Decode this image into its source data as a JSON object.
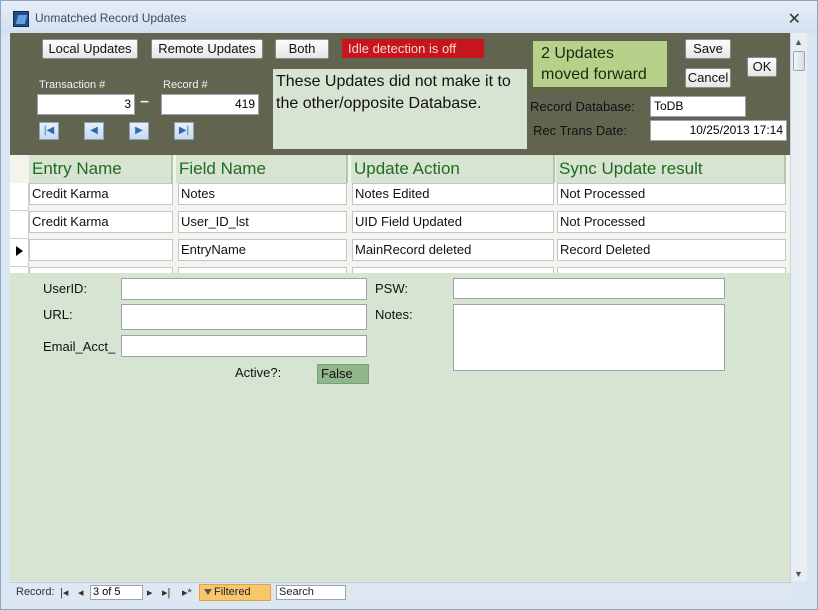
{
  "window": {
    "title": "Unmatched Record Updates",
    "close_glyph": "✕"
  },
  "toolbar": {
    "local_updates": "Local Updates",
    "remote_updates": "Remote Updates",
    "both": "Both",
    "idle_status": "Idle detection is off",
    "updates_count_text": "2 Updates moved forward",
    "save": "Save",
    "cancel": "Cancel",
    "ok": "OK"
  },
  "record_nav": {
    "transaction_label": "Transaction #",
    "transaction_value": "3",
    "dash": "–",
    "record_label": "Record #",
    "record_value": "419",
    "buttons": [
      "first-record-icon",
      "previous-record-icon",
      "next-record-icon",
      "last-record-icon"
    ]
  },
  "message": "These Updates did not make it to the other/opposite Database.",
  "record_info": {
    "database_label": "Record Database:",
    "database_value": "ToDB",
    "trans_date_label": "Rec Trans Date:",
    "trans_date_value": "10/25/2013 17:14"
  },
  "grid": {
    "columns": [
      "Entry Name",
      "Field Name",
      "Update Action",
      "Sync Update result"
    ],
    "rows": [
      [
        "Credit Karma",
        "Notes",
        "Notes Edited",
        "Not Processed"
      ],
      [
        "Credit Karma",
        "User_ID_lst",
        "UID Field Updated",
        "Not Processed"
      ],
      [
        "",
        "EntryName",
        "MainRecord deleted",
        "Record Deleted"
      ]
    ],
    "selected_row": 2
  },
  "detail": {
    "userid_label": "UserID:",
    "url_label": "URL:",
    "email_label": "Email_Acct_",
    "psw_label": "PSW:",
    "notes_label": "Notes:",
    "active_label": "Active?:",
    "active_value": "False"
  },
  "statusbar": {
    "record_label": "Record:",
    "record_position": "3 of 5",
    "filtered": "Filtered",
    "search": "Search"
  },
  "colors": {
    "header_bg": "#636450",
    "idle_red": "#c4161c",
    "updates_green": "#b7d18a",
    "column_text": "#1f6b1f",
    "active_value_bg": "#8fb78b"
  }
}
